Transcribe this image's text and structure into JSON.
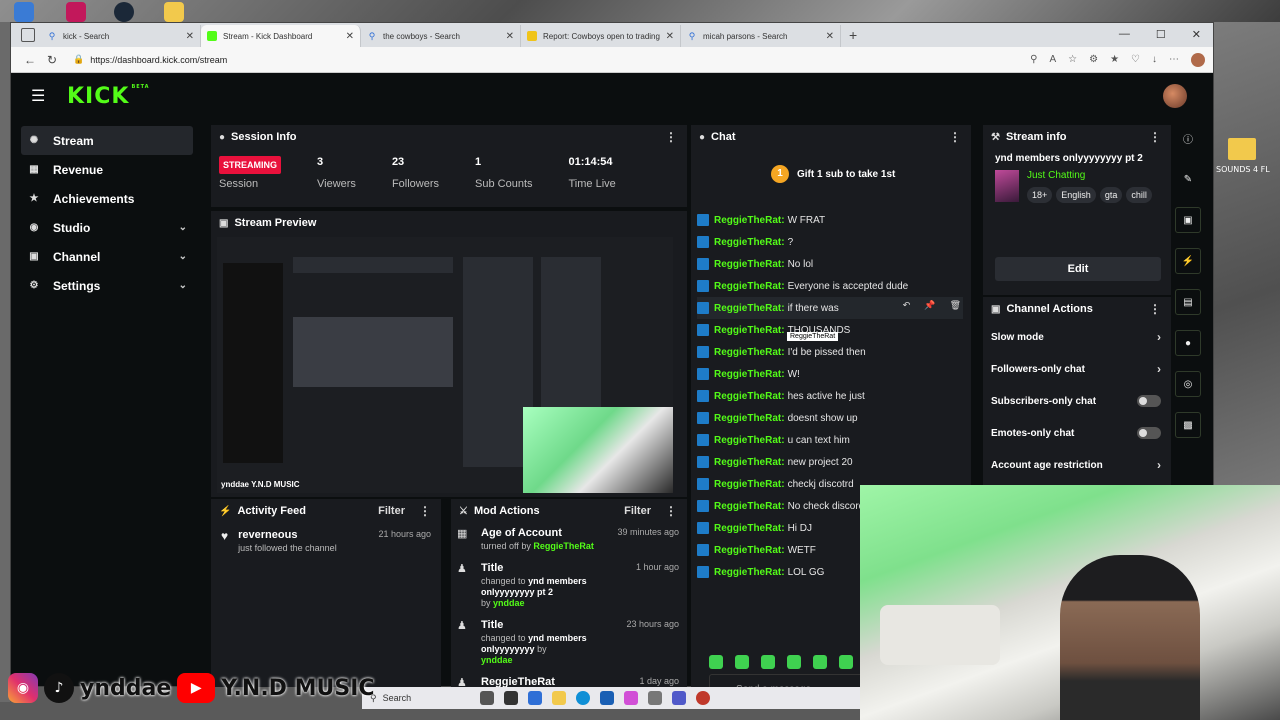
{
  "browser": {
    "tabs": [
      {
        "title": "kick - Search",
        "icon": "search-icon",
        "active": false
      },
      {
        "title": "Stream - Kick Dashboard",
        "icon": "kick-icon",
        "active": true
      },
      {
        "title": "the cowboys - Search",
        "icon": "search-icon",
        "active": false
      },
      {
        "title": "Report: Cowboys open to trading",
        "icon": "news-icon",
        "active": false
      },
      {
        "title": "micah parsons - Search",
        "icon": "search-icon",
        "active": false
      }
    ],
    "url": "https://dashboard.kick.com/stream"
  },
  "app": {
    "logo": "KICK",
    "logo_sup": "BETA"
  },
  "sidebar": {
    "items": [
      {
        "label": "Stream",
        "icon": "stream-icon",
        "active": true,
        "expandable": false
      },
      {
        "label": "Revenue",
        "icon": "revenue-icon",
        "active": false,
        "expandable": false
      },
      {
        "label": "Achievements",
        "icon": "trophy-icon",
        "active": false,
        "expandable": false
      },
      {
        "label": "Studio",
        "icon": "studio-icon",
        "active": false,
        "expandable": true
      },
      {
        "label": "Channel",
        "icon": "channel-icon",
        "active": false,
        "expandable": true
      },
      {
        "label": "Settings",
        "icon": "gear-icon",
        "active": false,
        "expandable": true
      }
    ]
  },
  "session": {
    "title": "Session Info",
    "status": "STREAMING",
    "status_label": "Session",
    "stats": [
      {
        "value": "3",
        "label": "Viewers"
      },
      {
        "value": "23",
        "label": "Followers"
      },
      {
        "value": "1",
        "label": "Sub Counts"
      },
      {
        "value": "01:14:54",
        "label": "Time Live"
      }
    ]
  },
  "preview": {
    "title": "Stream Preview",
    "caption": "ynddae  Y.N.D MUSIC"
  },
  "activity": {
    "title": "Activity Feed",
    "filter": "Filter",
    "items": [
      {
        "user": "reverneous",
        "action": "just followed the channel",
        "time": "21 hours ago"
      }
    ]
  },
  "mod": {
    "title": "Mod Actions",
    "filter": "Filter",
    "items": [
      {
        "title": "Age of Account",
        "line1": "turned off by",
        "user": "ReggieTheRat",
        "extra": "",
        "time": "39 minutes ago",
        "icon": "calendar-icon"
      },
      {
        "title": "Title",
        "line1": "changed to",
        "value": "ynd members onlyyyyyyyy pt 2",
        "by": "by",
        "user": "ynddae",
        "time": "1 hour ago",
        "icon": "user-icon"
      },
      {
        "title": "Title",
        "line1": "changed to",
        "value": "ynd members onlyyyyyyyy",
        "by": "by",
        "user": "ynddae",
        "time": "23 hours ago",
        "icon": "user-icon"
      },
      {
        "title": "ReggieTheRat",
        "line1": "",
        "value": "",
        "by": "",
        "user": "",
        "time": "1 day ago",
        "icon": "user-icon"
      }
    ]
  },
  "chat": {
    "title": "Chat",
    "gift_text": "Gift 1 sub to take 1st",
    "gift_count": "1",
    "messages": [
      {
        "user": "ReggieTheRat:",
        "text": "W FRAT"
      },
      {
        "user": "ReggieTheRat:",
        "text": "?"
      },
      {
        "user": "ReggieTheRat:",
        "text": "No lol"
      },
      {
        "user": "ReggieTheRat:",
        "text": "Everyone is accepted dude"
      },
      {
        "user": "ReggieTheRat:",
        "text": "if there was"
      },
      {
        "user": "ReggieTheRat:",
        "text": "THOUSANDS"
      },
      {
        "user": "ReggieTheRat:",
        "text": "I'd be pissed then"
      },
      {
        "user": "ReggieTheRat:",
        "text": "W!"
      },
      {
        "user": "ReggieTheRat:",
        "text": "hes active he just"
      },
      {
        "user": "ReggieTheRat:",
        "text": "doesnt show up"
      },
      {
        "user": "ReggieTheRat:",
        "text": "u can text him"
      },
      {
        "user": "ReggieTheRat:",
        "text": "new project 20"
      },
      {
        "user": "ReggieTheRat:",
        "text": "checkj discotrd"
      },
      {
        "user": "ReggieTheRat:",
        "text": "No check discord"
      },
      {
        "user": "ReggieTheRat:",
        "text": "Hi DJ"
      },
      {
        "user": "ReggieTheRat:",
        "text": "WETF"
      },
      {
        "user": "ReggieTheRat:",
        "text": "LOL GG"
      }
    ],
    "tooltip": "ReggieTheRat",
    "placeholder": "Send a message"
  },
  "stream_info": {
    "title": "Stream info",
    "stream_title": "ynd members onlyyyyyyyy pt 2",
    "category": "Just Chatting",
    "tags": [
      "18+",
      "English",
      "gta",
      "chill"
    ],
    "edit": "Edit"
  },
  "channel_actions": {
    "title": "Channel Actions",
    "items": [
      {
        "label": "Slow mode",
        "type": "arrow"
      },
      {
        "label": "Followers-only chat",
        "type": "arrow"
      },
      {
        "label": "Subscribers-only chat",
        "type": "toggle"
      },
      {
        "label": "Emotes-only chat",
        "type": "toggle"
      },
      {
        "label": "Account age restriction",
        "type": "arrow"
      }
    ]
  },
  "overlay": {
    "instagram": "ynddae",
    "youtube": "Y.N.D MUSIC"
  },
  "desktop": {
    "folder_label": "SOUNDS 4 FL"
  },
  "taskbar": {
    "search": "Search"
  },
  "colors": {
    "accent": "#53fc18",
    "live": "#e9113c",
    "panel": "#191b1f",
    "background": "#0b0e0f"
  }
}
